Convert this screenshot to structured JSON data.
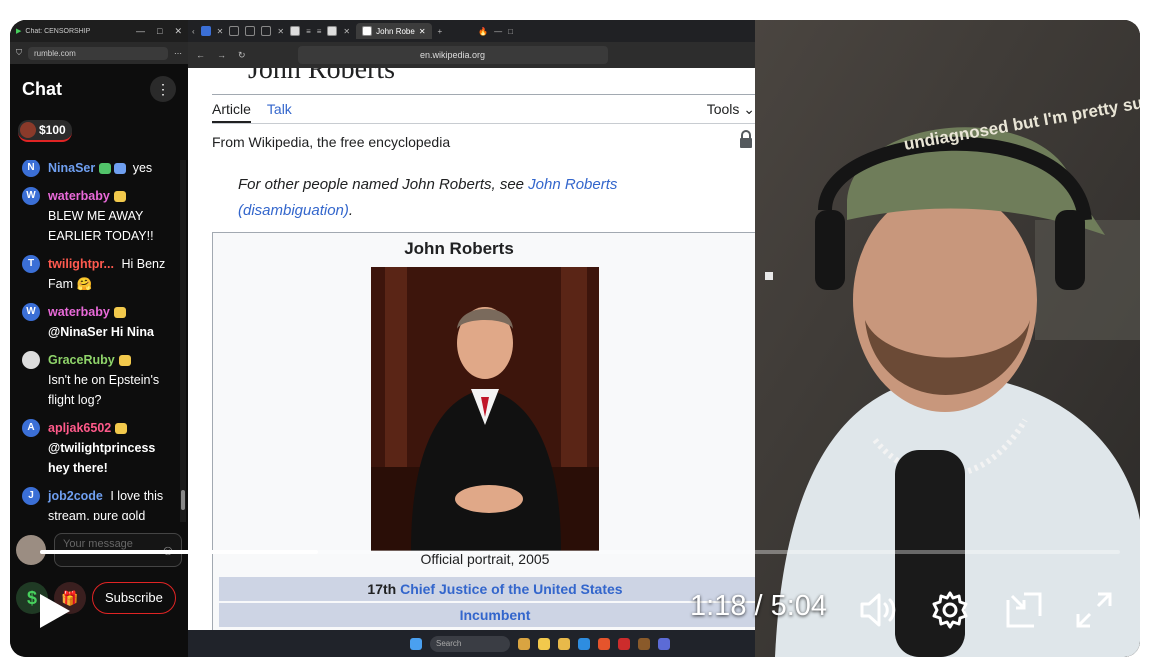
{
  "chat_window": {
    "title": "Chat: CENSORSHIP",
    "url": "rumble.com",
    "header": "Chat",
    "rant_amount": "$100",
    "messages": [
      {
        "initial": "N",
        "user": "NinaSer",
        "text": "yes",
        "color": "#8ab4f8"
      },
      {
        "initial": "W",
        "user": "waterbaby",
        "text": "BLEW ME AWAY EARLIER TODAY!!",
        "color": "#e96ad9"
      },
      {
        "initial": "T",
        "user": "twilightpr...",
        "text": "Hi Benz Fam 🤗",
        "color": "#ff5a4f"
      },
      {
        "initial": "W",
        "user": "waterbaby",
        "text": "@NinaSer Hi Nina",
        "color": "#e96ad9"
      },
      {
        "initial": "",
        "user": "GraceRuby",
        "text": "Isn't he on Epstein's flight log?",
        "color": "#8fd46a"
      },
      {
        "initial": "A",
        "user": "apljak6502",
        "text": "@twilightprincess hey there!",
        "color": "#ff5a8a"
      },
      {
        "initial": "J",
        "user": "job2code",
        "text": "I love this stream, pure gold",
        "color": "#6f9ff0"
      }
    ],
    "input_placeholder": "Your message",
    "subscribe_label": "Subscribe"
  },
  "browser": {
    "active_tab": "John Robe",
    "url": "en.wikipedia.org",
    "page": {
      "title": "John Roberts",
      "tabs": [
        "Article",
        "Talk"
      ],
      "tools": "Tools",
      "tagline": "From Wikipedia, the free encyclopedia",
      "hatnote_prefix": "For other people named John Roberts, see ",
      "hatnote_link": "John Roberts (disambiguation)",
      "hatnote_suffix": ".",
      "infobox": {
        "name": "John Roberts",
        "caption": "Official portrait, 2005",
        "office_ordinal": "17th",
        "office": "Chief Justice of the United States",
        "status": "Incumbent"
      }
    },
    "taskbar_search": "Search"
  },
  "player": {
    "current_time": "1:18",
    "duration": "5:04",
    "time_display": "1:18 / 5:04",
    "progress_fraction": 0.257,
    "icons": [
      "play-icon",
      "volume-icon",
      "settings-icon",
      "pip-icon",
      "fullscreen-icon"
    ]
  },
  "webcam": {
    "hat_text": "undiagnosed but I'm pretty sure"
  }
}
